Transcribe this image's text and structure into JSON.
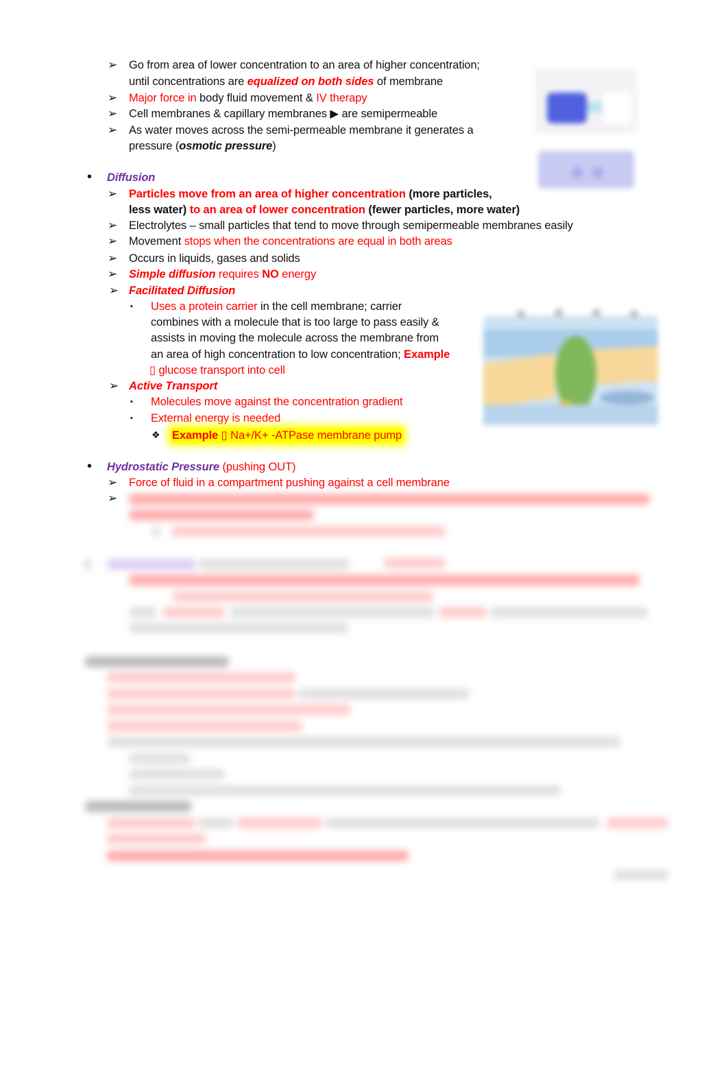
{
  "osmosis_points": [
    {
      "line1": "Go from area of lower concentration to an area of higher concentration;",
      "line2_pre": "until concentrations are ",
      "line2_em": "equalized on both sides",
      "line2_post": " of membrane"
    },
    {
      "red1": "Major force in",
      "mid": " body fluid movement & ",
      "red2": "IV therapy"
    },
    {
      "pre": "Cell membranes & capillary membranes ",
      "arrow": "▶",
      "post": " are semipermeable"
    },
    {
      "line1": "As water moves across the semi-permeable membrane it generates a",
      "line2_pre": "pressure (",
      "line2_em": "osmotic pressure",
      "line2_post": ")"
    }
  ],
  "diffusion": {
    "heading": "Diffusion",
    "points": [
      {
        "red1": "Particles move from an area of higher concentration",
        "black1": " (more particles,",
        "black2": "less water) ",
        "red2": "to an area of lower concentration",
        "black3": " (fewer particles, more water)"
      },
      {
        "text": "Electrolytes – small particles that tend to move through semipermeable membranes easily"
      },
      {
        "pre": "Movement ",
        "red": "stops when the concentrations are equal in both areas"
      },
      {
        "text": "Occurs in liquids, gases and solids"
      },
      {
        "em": "Simple diffusion",
        "mid": " requires ",
        "bold": "NO",
        "post": " energy"
      }
    ],
    "facilitated": {
      "heading": "Facilitated Diffusion",
      "lines": {
        "l1_red": "Uses a protein carrier",
        "l1_post": " in the cell membrane; carrier",
        "l2": "combines with a molecule that is too large to pass easily &",
        "l3": "assists in moving the molecule across the membrane from",
        "l4_pre": "an area of high concentration to low concentration; ",
        "l4_bold": "Example",
        "l5": " glucose transport into cell",
        "missing_glyph": "▯"
      }
    },
    "active": {
      "heading": "Active Transport",
      "points": [
        "Molecules move against the concentration gradient",
        "External energy is needed"
      ],
      "example_bold": "Example",
      "missing_glyph": "▯",
      "example_text": " Na+/K+ -ATPase membrane pump"
    }
  },
  "hydrostatic": {
    "heading": "Hydrostatic Pressure",
    "suffix": " (pushing OUT)",
    "points": [
      "Force of fluid in a compartment pushing against a cell membrane"
    ]
  },
  "bullets": {
    "arrow": "➢",
    "dot": "•",
    "square": "▪",
    "diamond": "❖"
  },
  "colors": {
    "red": "#ff0000",
    "purple": "#7030a0",
    "highlight": "#ffff00",
    "text": "#111111"
  },
  "figures": [
    {
      "name": "osmosis-diagram"
    },
    {
      "name": "cell-membrane-protein-carrier-diagram"
    }
  ]
}
